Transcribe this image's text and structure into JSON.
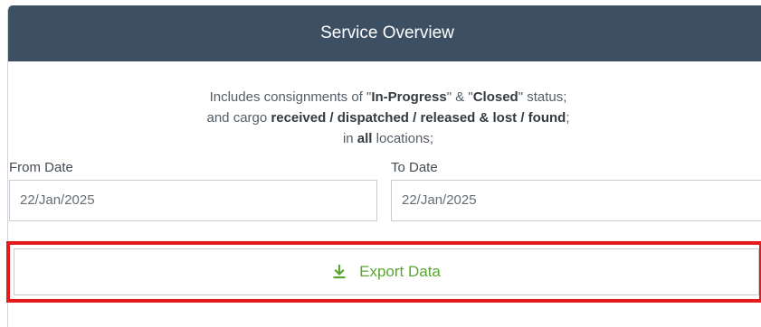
{
  "header": {
    "title": "Service Overview"
  },
  "info": {
    "line1_prefix": "Includes consignments of \"",
    "line1_bold1": "In-Progress",
    "line1_mid": "\" & \"",
    "line1_bold2": "Closed",
    "line1_suffix": "\" status;",
    "line2_prefix": "and cargo ",
    "line2_bold": "received / dispatched / released & lost / found",
    "line2_suffix": ";",
    "line3_prefix": "in ",
    "line3_bold": "all",
    "line3_suffix": " locations;"
  },
  "from_date": {
    "label": "From Date",
    "value": "22/Jan/2025"
  },
  "to_date": {
    "label": "To Date",
    "value": "22/Jan/2025"
  },
  "export": {
    "label": "Export Data",
    "icon": "download-icon"
  },
  "colors": {
    "header_bg": "#3d4f63",
    "highlight": "#e31b1b",
    "accent_green": "#5aa630"
  }
}
